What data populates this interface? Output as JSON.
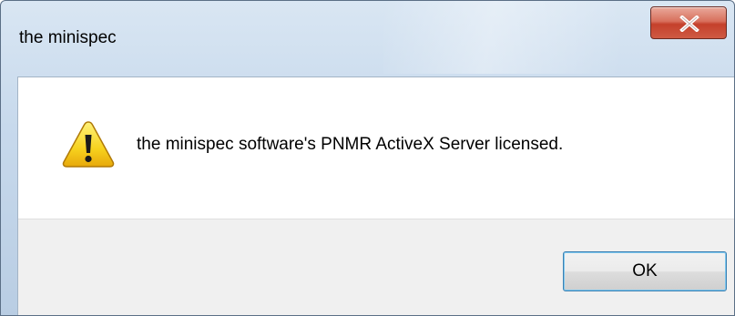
{
  "window": {
    "title": "the minispec",
    "close_icon": "close-icon"
  },
  "message": {
    "icon": "warning-icon",
    "text": "the minispec software's PNMR ActiveX Server licensed."
  },
  "buttons": {
    "ok_label": "OK"
  },
  "colors": {
    "close_button": "#c7432e",
    "warning_yellow": "#f5c518",
    "ok_border": "#3c7fb1"
  }
}
